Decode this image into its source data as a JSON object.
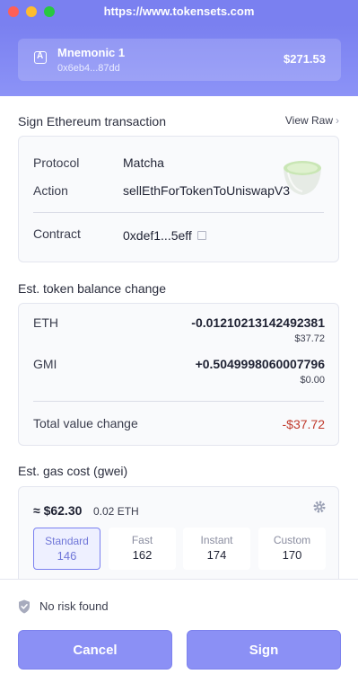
{
  "window": {
    "url": "https://www.tokensets.com"
  },
  "account": {
    "name": "Mnemonic 1",
    "address": "0x6eb4...87dd",
    "balance": "$271.53",
    "icon": "wallet-icon"
  },
  "transaction": {
    "title": "Sign Ethereum transaction",
    "view_raw": "View Raw",
    "protocol_label": "Protocol",
    "protocol_value": "Matcha",
    "action_label": "Action",
    "action_value": "sellEthForTokenToUniswapV3",
    "contract_label": "Contract",
    "contract_value": "0xdef1...5eff"
  },
  "balance_change": {
    "title": "Est. token balance change",
    "tokens": [
      {
        "name": "ETH",
        "amount": "-0.01210213142492381",
        "usd": "$37.72"
      },
      {
        "name": "GMI",
        "amount": "+0.5049998060007796",
        "usd": "$0.00"
      }
    ],
    "total_label": "Total value change",
    "total_value": "-$37.72"
  },
  "gas": {
    "title": "Est. gas cost (gwei)",
    "price_usd": "≈ $62.30",
    "price_eth": "0.02 ETH",
    "options": [
      {
        "label": "Standard",
        "value": "146"
      },
      {
        "label": "Fast",
        "value": "162"
      },
      {
        "label": "Instant",
        "value": "174"
      },
      {
        "label": "Custom",
        "value": "170"
      }
    ],
    "selected": "Standard"
  },
  "footer": {
    "risk_text": "No risk found",
    "cancel_label": "Cancel",
    "sign_label": "Sign"
  },
  "colors": {
    "accent": "#7a80f0",
    "negative": "#c0392b",
    "button": "#8b90f5"
  }
}
